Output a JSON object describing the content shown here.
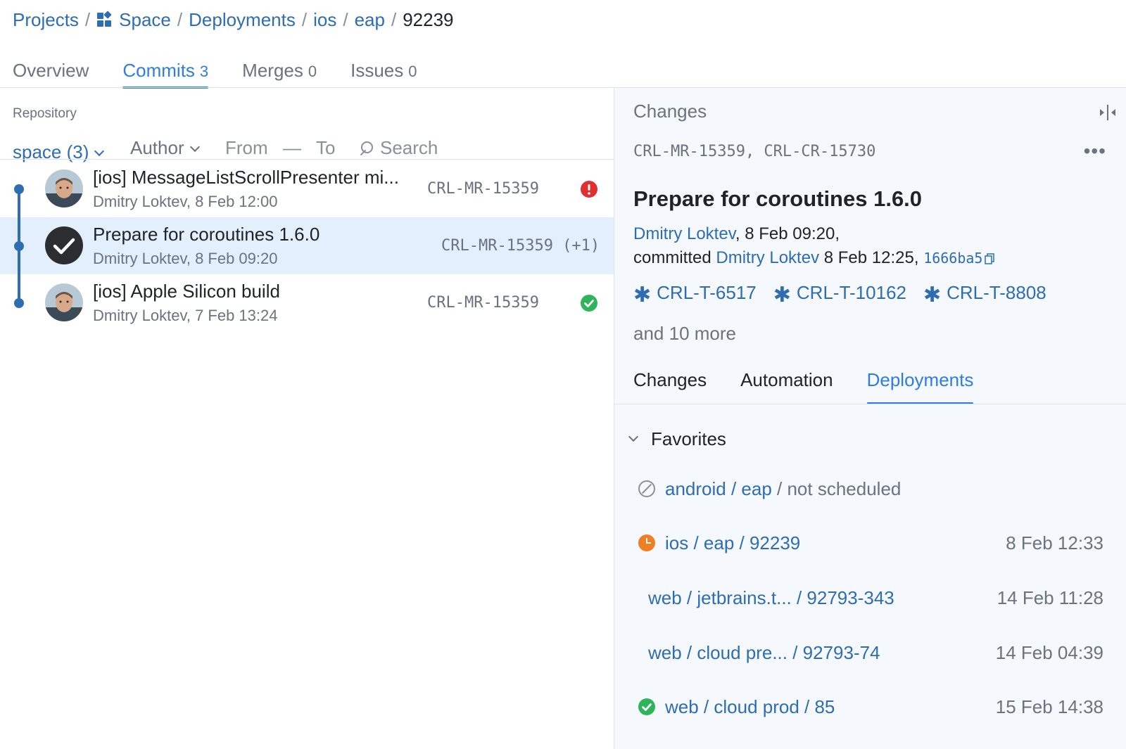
{
  "breadcrumb": {
    "items": [
      "Projects",
      "Space",
      "Deployments",
      "ios",
      "eap"
    ],
    "current": "92239",
    "separator": "/"
  },
  "top_tabs": [
    {
      "label": "Overview",
      "count": ""
    },
    {
      "label": "Commits",
      "count": "3",
      "active": true
    },
    {
      "label": "Merges",
      "count": "0"
    },
    {
      "label": "Issues",
      "count": "0"
    }
  ],
  "filters": {
    "repository_caption": "Repository",
    "repository_value": "space (3)",
    "author": "Author",
    "from": "From",
    "dash": "—",
    "to": "To",
    "search_placeholder": "Search"
  },
  "commits": [
    {
      "title": "[ios] MessageListScrollPresenter mi...",
      "meta": "Dmitry Loktev, 8 Feb 12:00",
      "ref": "CRL-MR-15359",
      "status": "error"
    },
    {
      "title": "Prepare for coroutines 1.6.0",
      "meta": "Dmitry Loktev, 8 Feb 09:20",
      "ref": "CRL-MR-15359 (+1)",
      "status": "selected"
    },
    {
      "title": "[ios] Apple Silicon build",
      "meta": "Dmitry Loktev, 7 Feb 13:24",
      "ref": "CRL-MR-15359",
      "status": "ok"
    }
  ],
  "details": {
    "panel_title": "Changes",
    "refs": "CRL-MR-15359, CRL-CR-15730",
    "title": "Prepare for coroutines 1.6.0",
    "author": "Dmitry Loktev",
    "authored_at": ", 8 Feb 09:20,",
    "committed_label": "committed",
    "committer": "Dmitry Loktev",
    "committed_at": " 8 Feb 12:25, ",
    "hash": "1666ba5",
    "issues": [
      "CRL-T-6517",
      "CRL-T-10162",
      "CRL-T-8808"
    ],
    "and_more": "and 10 more",
    "tabs": [
      {
        "label": "Changes"
      },
      {
        "label": "Automation"
      },
      {
        "label": "Deployments",
        "active": true
      }
    ],
    "favorites_label": "Favorites",
    "deployments": [
      {
        "status": "none",
        "name": "android / eap",
        "suffix": " / not scheduled",
        "time": ""
      },
      {
        "status": "running",
        "name": "ios / eap / 92239",
        "suffix": "",
        "time": "8 Feb 12:33"
      },
      {
        "status": "none-icon",
        "name": "web / jetbrains.t...  / 92793-343",
        "suffix": "",
        "time": "14 Feb 11:28"
      },
      {
        "status": "none-icon",
        "name": "web / cloud pre...  / 92793-74",
        "suffix": "",
        "time": "14 Feb 04:39"
      },
      {
        "status": "ok",
        "name": "web / cloud prod / 85",
        "suffix": "",
        "time": "15 Feb 14:38"
      }
    ]
  },
  "colors": {
    "accent": "#2f7de1",
    "link": "#2f6db3",
    "error": "#e02f2f",
    "success": "#2fb45a",
    "running": "#f07f24",
    "selected_row": "#e3effc"
  }
}
